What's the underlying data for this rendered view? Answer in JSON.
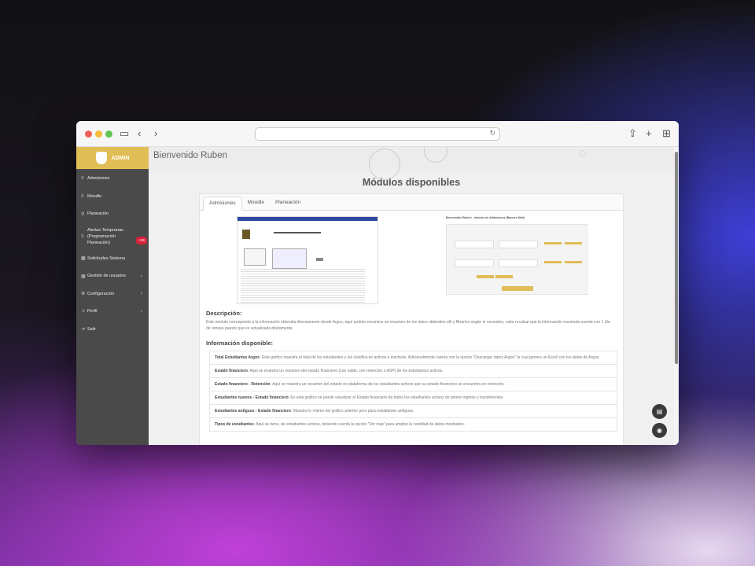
{
  "sidebar": {
    "brand": "ADMIN",
    "items": [
      {
        "label": "Admisiones",
        "icon": "list-icon"
      },
      {
        "label": "Moodle",
        "icon": "list-icon"
      },
      {
        "label": "Planeación",
        "icon": "pin-icon"
      },
      {
        "label": "Alertas Tempranas (Programación Planeación)",
        "icon": "list-icon",
        "badge": "+99"
      },
      {
        "label": "Solicitudes Sistema",
        "icon": "grid-icon"
      },
      {
        "label": "Gestión de usuarios",
        "icon": "grid-icon"
      },
      {
        "label": "Configuración",
        "icon": "gear-icon"
      },
      {
        "label": "Perfil",
        "icon": "users-icon"
      },
      {
        "label": "Salir",
        "icon": "exit-icon"
      }
    ]
  },
  "header": {
    "welcome": "Bienvenido Ruben"
  },
  "main": {
    "title": "Módulos disponibles",
    "tabs": [
      "Admisiones",
      "Moodle",
      "Planeación"
    ],
    "shot_title": "Bienvenido Ruben! - Informe de Admisiones (Banner-Web)",
    "desc_heading": "Descripción:",
    "desc_text": "Este módulo corresponde a la información obtenida directamente desde Argos, aquí podrás encontrar un resumen de los datos obtenidos allí y filtrarlos según lo necesites, cabe recalcar que la información mostrada cuenta con 1 día de retraso puesto que es actualizada diariamente.",
    "info_heading": "Información disponible:",
    "info": [
      {
        "title": "Total Estudiantes Argos",
        "text": ": Este gráfico muestra el total de los estudiantes y los clasifica en activos e inactivos. Adicionalmente cuenta con la opción \"Descargar datos Argos\" la cual genera un Excel con los datos de Argos."
      },
      {
        "title": "Estado financiero",
        "text": ": Aquí se muestra un resumen del estado financiero (con saldo, con retención o ASP) de los estudiantes activos."
      },
      {
        "title": "Estado financiero - Retención",
        "text": ": Aquí se muestra un resumen del estado en plataforma de los estudiantes activos que su estado financiero se encuentra en retención."
      },
      {
        "title": "Estudiantes nuevos - Estado financiero",
        "text": ": En este gráfico se puede visualizar el Estado financiero de todos los estudiantes activos de primer ingreso y transferentes."
      },
      {
        "title": "Estudiantes antiguos - Estado financiero",
        "text": ": Muestra lo mismo del gráfico anterior pero para estudiantes antiguos."
      },
      {
        "title": "Tipos de estudiantes",
        "text": ": Aquí se tiene, de estudiantes activos, teniendo cuenta la opción \"Ver más\" para ampliar la cantidad de datos mostrados."
      }
    ]
  },
  "colors": {
    "accent": "#e0bd55",
    "sidebar": "#4a4a4a",
    "badge": "#d9223a"
  }
}
